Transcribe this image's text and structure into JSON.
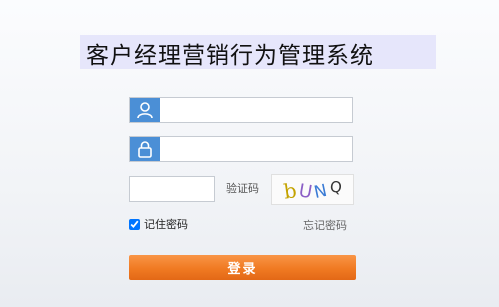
{
  "header": {
    "title": "客户经理营销行为管理系统"
  },
  "form": {
    "username": {
      "icon": "user-icon",
      "value": "",
      "placeholder": ""
    },
    "password": {
      "icon": "lock-icon",
      "value": "",
      "placeholder": ""
    },
    "captcha": {
      "value": "",
      "label": "验证码",
      "image_text": "bUNQ"
    },
    "remember_label": "记住密码",
    "remember_checked": true,
    "forgot_label": "忘记密码",
    "login_label": "登录"
  },
  "colors": {
    "accent_blue": "#4b8fd6",
    "login_orange": "#f07a22",
    "title_band": "#e6e6fb"
  }
}
